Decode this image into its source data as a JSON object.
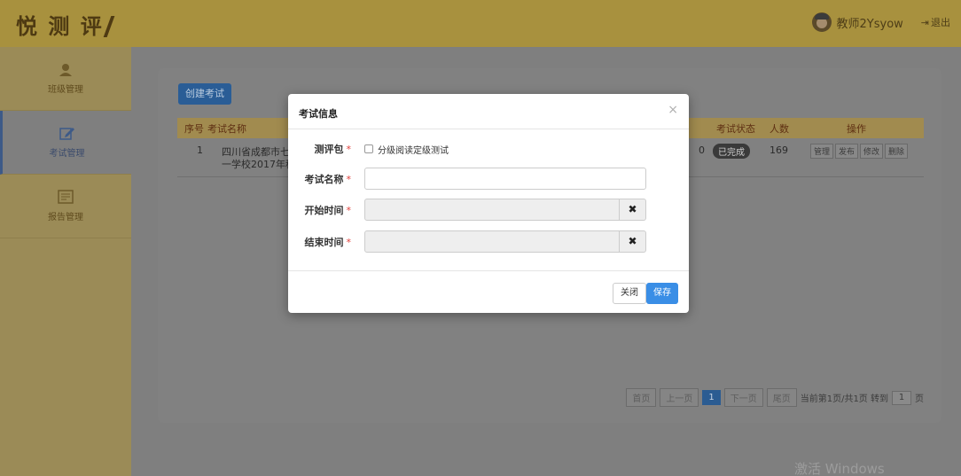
{
  "app": {
    "logo": "悦 测 评",
    "user_name": "教师2Ysyow",
    "logout_label": "退出"
  },
  "sidebar": {
    "items": [
      {
        "label": "班级管理",
        "icon": "class-icon"
      },
      {
        "label": "考试管理",
        "icon": "edit-icon"
      },
      {
        "label": "报告管理",
        "icon": "report-icon"
      }
    ]
  },
  "main": {
    "create_button": "创建考试",
    "table": {
      "columns": [
        "序号",
        "考试名称",
        "考试状态",
        "人数",
        "操作"
      ],
      "rows": [
        {
          "index": "1",
          "name_line1": "四川省成都市七中",
          "name_line2": "一学校2017年秋",
          "extra": "0",
          "status": "已完成",
          "count": "169",
          "ops": [
            "管理",
            "发布",
            "修改",
            "删除"
          ]
        }
      ]
    },
    "pager": {
      "first": "首页",
      "prev": "上一页",
      "current": "1",
      "next": "下一页",
      "last": "尾页",
      "info": "当前第1页/共1页 转到",
      "goto_value": "1",
      "page_suffix": "页"
    }
  },
  "modal": {
    "title": "考试信息",
    "close_symbol": "×",
    "fields": {
      "package_label": "测评包",
      "package_option": "分级阅读定级测试",
      "name_label": "考试名称",
      "start_label": "开始时间",
      "end_label": "结束时间",
      "required_mark": "*",
      "clear_symbol": "✖"
    },
    "buttons": {
      "close": "关闭",
      "save": "保存"
    }
  },
  "watermark": "激活 Windows"
}
